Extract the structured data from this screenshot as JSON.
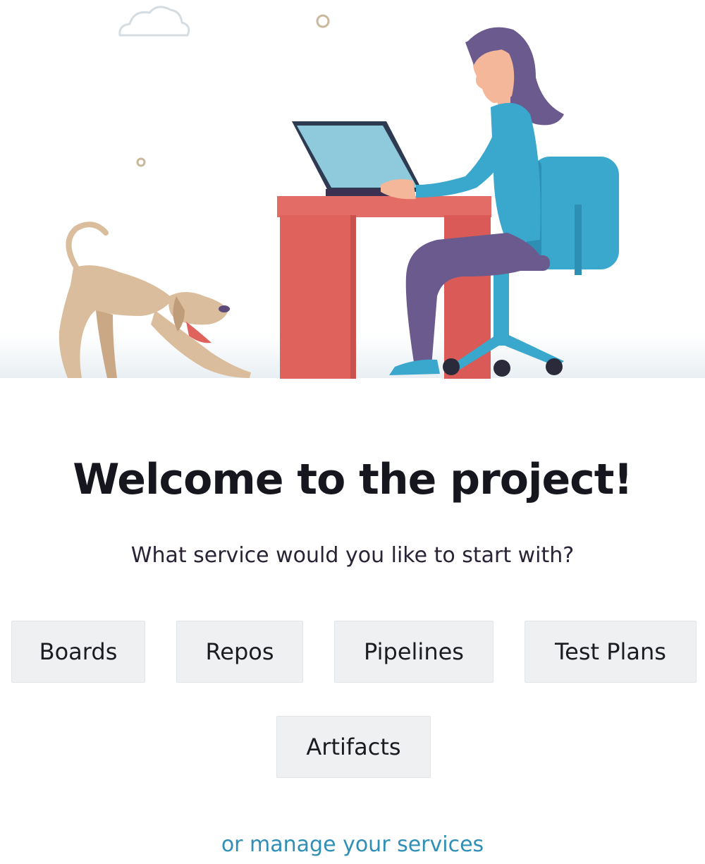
{
  "welcome": {
    "title": "Welcome to the project!",
    "subtitle": "What service would you like to start with?"
  },
  "services": {
    "boards": "Boards",
    "repos": "Repos",
    "pipelines": "Pipelines",
    "test_plans": "Test Plans",
    "artifacts": "Artifacts"
  },
  "manage_link": "or manage your services",
  "colors": {
    "button_bg": "#eef0f2",
    "link": "#2f8fb6",
    "title": "#16161f",
    "desk": "#e06a66",
    "laptop_screen": "#8ec9dc",
    "shirt": "#3aa7cc",
    "hair_pants": "#6b5a8e",
    "dog": "#d9bd9c"
  }
}
